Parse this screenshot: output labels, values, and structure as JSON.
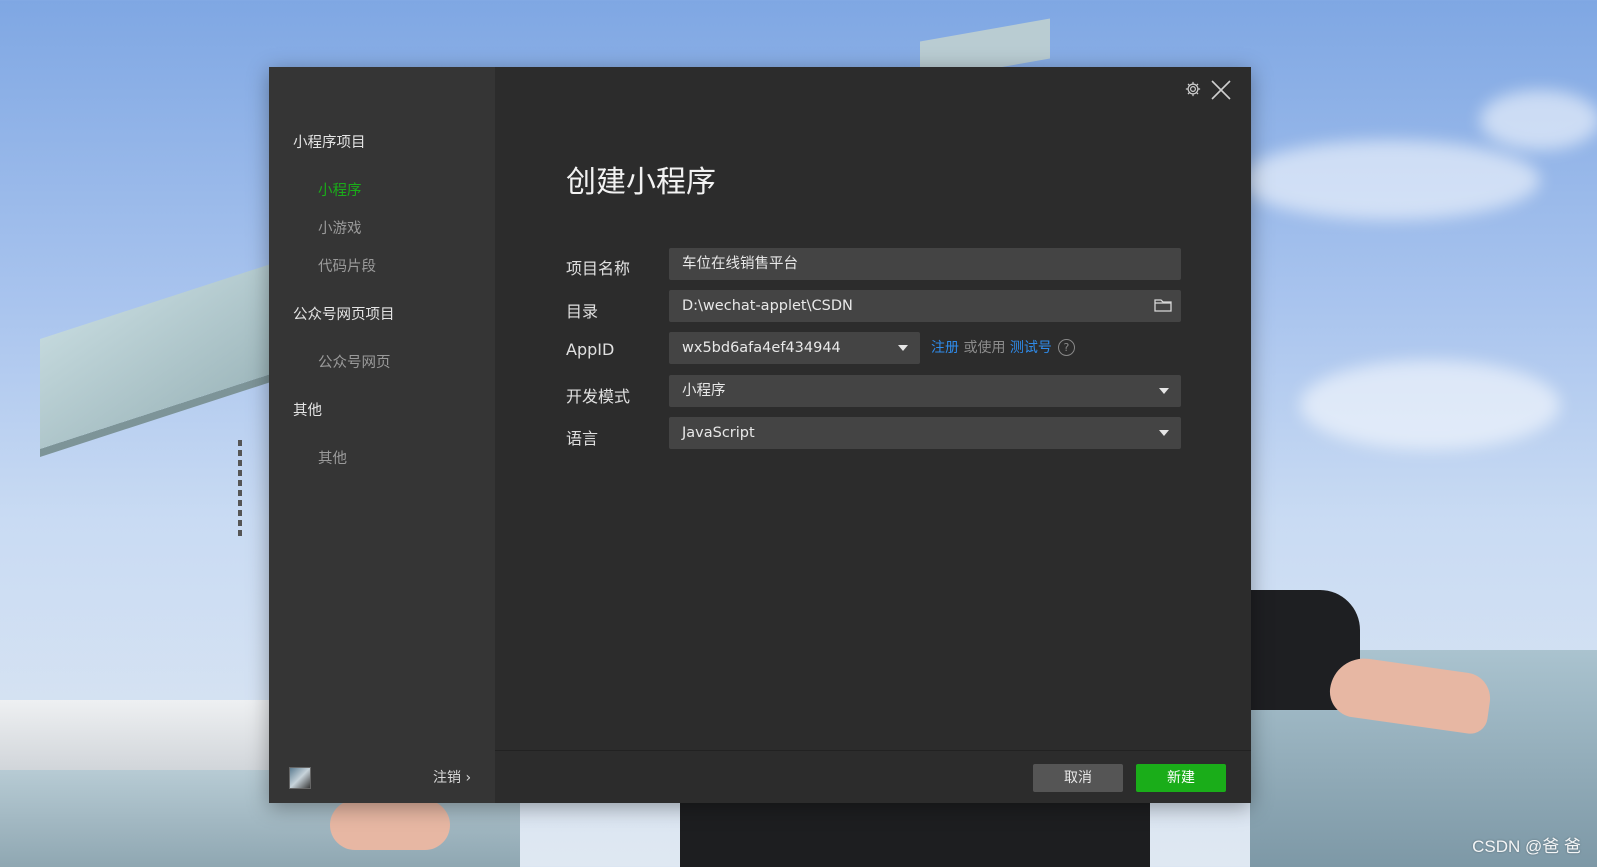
{
  "sidebar": {
    "groups": [
      {
        "label": "小程序项目",
        "items": [
          {
            "label": "小程序",
            "active": true
          },
          {
            "label": "小游戏"
          },
          {
            "label": "代码片段"
          }
        ]
      },
      {
        "label": "公众号网页项目",
        "items": [
          {
            "label": "公众号网页"
          }
        ]
      },
      {
        "label": "其他",
        "items": [
          {
            "label": "其他"
          }
        ]
      }
    ],
    "logout_label": "注销 ›"
  },
  "header": {
    "settings_icon": "gear-icon",
    "close_icon": "close-icon"
  },
  "main": {
    "title": "创建小程序",
    "form": {
      "project_name": {
        "label": "项目名称",
        "value": "车位在线销售平台"
      },
      "directory": {
        "label": "目录",
        "value": "D:\\wechat-applet\\CSDN",
        "icon": "folder-icon"
      },
      "appid": {
        "label": "AppID",
        "value": "wx5bd6afa4ef434944"
      },
      "dev_mode": {
        "label": "开发模式",
        "value": "小程序"
      },
      "language": {
        "label": "语言",
        "value": "JavaScript"
      }
    },
    "appid_links": {
      "register": "注册",
      "or_use": " 或使用 ",
      "test_account": "测试号",
      "help": "?"
    }
  },
  "footer": {
    "cancel_label": "取消",
    "create_label": "新建"
  },
  "watermark": "CSDN @爸  爸",
  "colors": {
    "accent": "#1aad19",
    "link": "#2f8bea",
    "dialog_bg": "#2c2c2c",
    "sidebar_bg": "#353535"
  }
}
